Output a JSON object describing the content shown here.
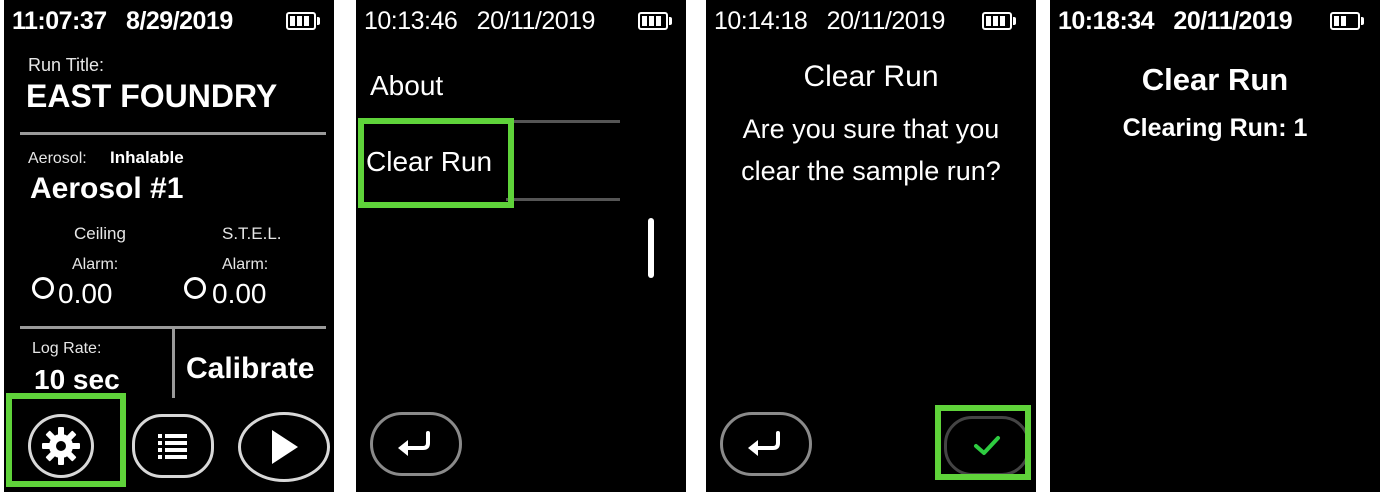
{
  "screens": [
    {
      "time": "11:07:37",
      "date": "8/29/2019",
      "run_title_label": "Run Title:",
      "run_title": "EAST FOUNDRY",
      "aerosol_label": "Aerosol:",
      "aerosol_type": "Inhalable",
      "aerosol_name": "Aerosol #1",
      "ceiling_label": "Ceiling",
      "ceiling_alarm_label": "Alarm:",
      "ceiling_value": "0.00",
      "stel_label": "S.T.E.L.",
      "stel_alarm_label": "Alarm:",
      "stel_value": "0.00",
      "log_rate_label": "Log Rate:",
      "log_rate_value": "10 sec",
      "calibrate_label": "Calibrate",
      "icons": [
        "gear-icon",
        "list-icon",
        "play-icon"
      ]
    },
    {
      "time": "10:13:46",
      "date": "20/11/2019",
      "menu_items": [
        "About",
        "Clear Run"
      ],
      "icons": [
        "back-arrow-icon"
      ]
    },
    {
      "time": "10:14:18",
      "date": "20/11/2019",
      "title": "Clear Run",
      "message_line1": "Are you sure that you",
      "message_line2": "clear the sample run?",
      "icons": [
        "back-arrow-icon",
        "checkmark-icon"
      ]
    },
    {
      "time": "10:18:34",
      "date": "20/11/2019",
      "title": "Clear Run",
      "status": "Clearing Run: 1"
    }
  ],
  "colors": {
    "highlight": "#5fd33a",
    "checkmark": "#2ecc40",
    "screen_bg": "#000000",
    "divider": "#9a9a9a"
  }
}
